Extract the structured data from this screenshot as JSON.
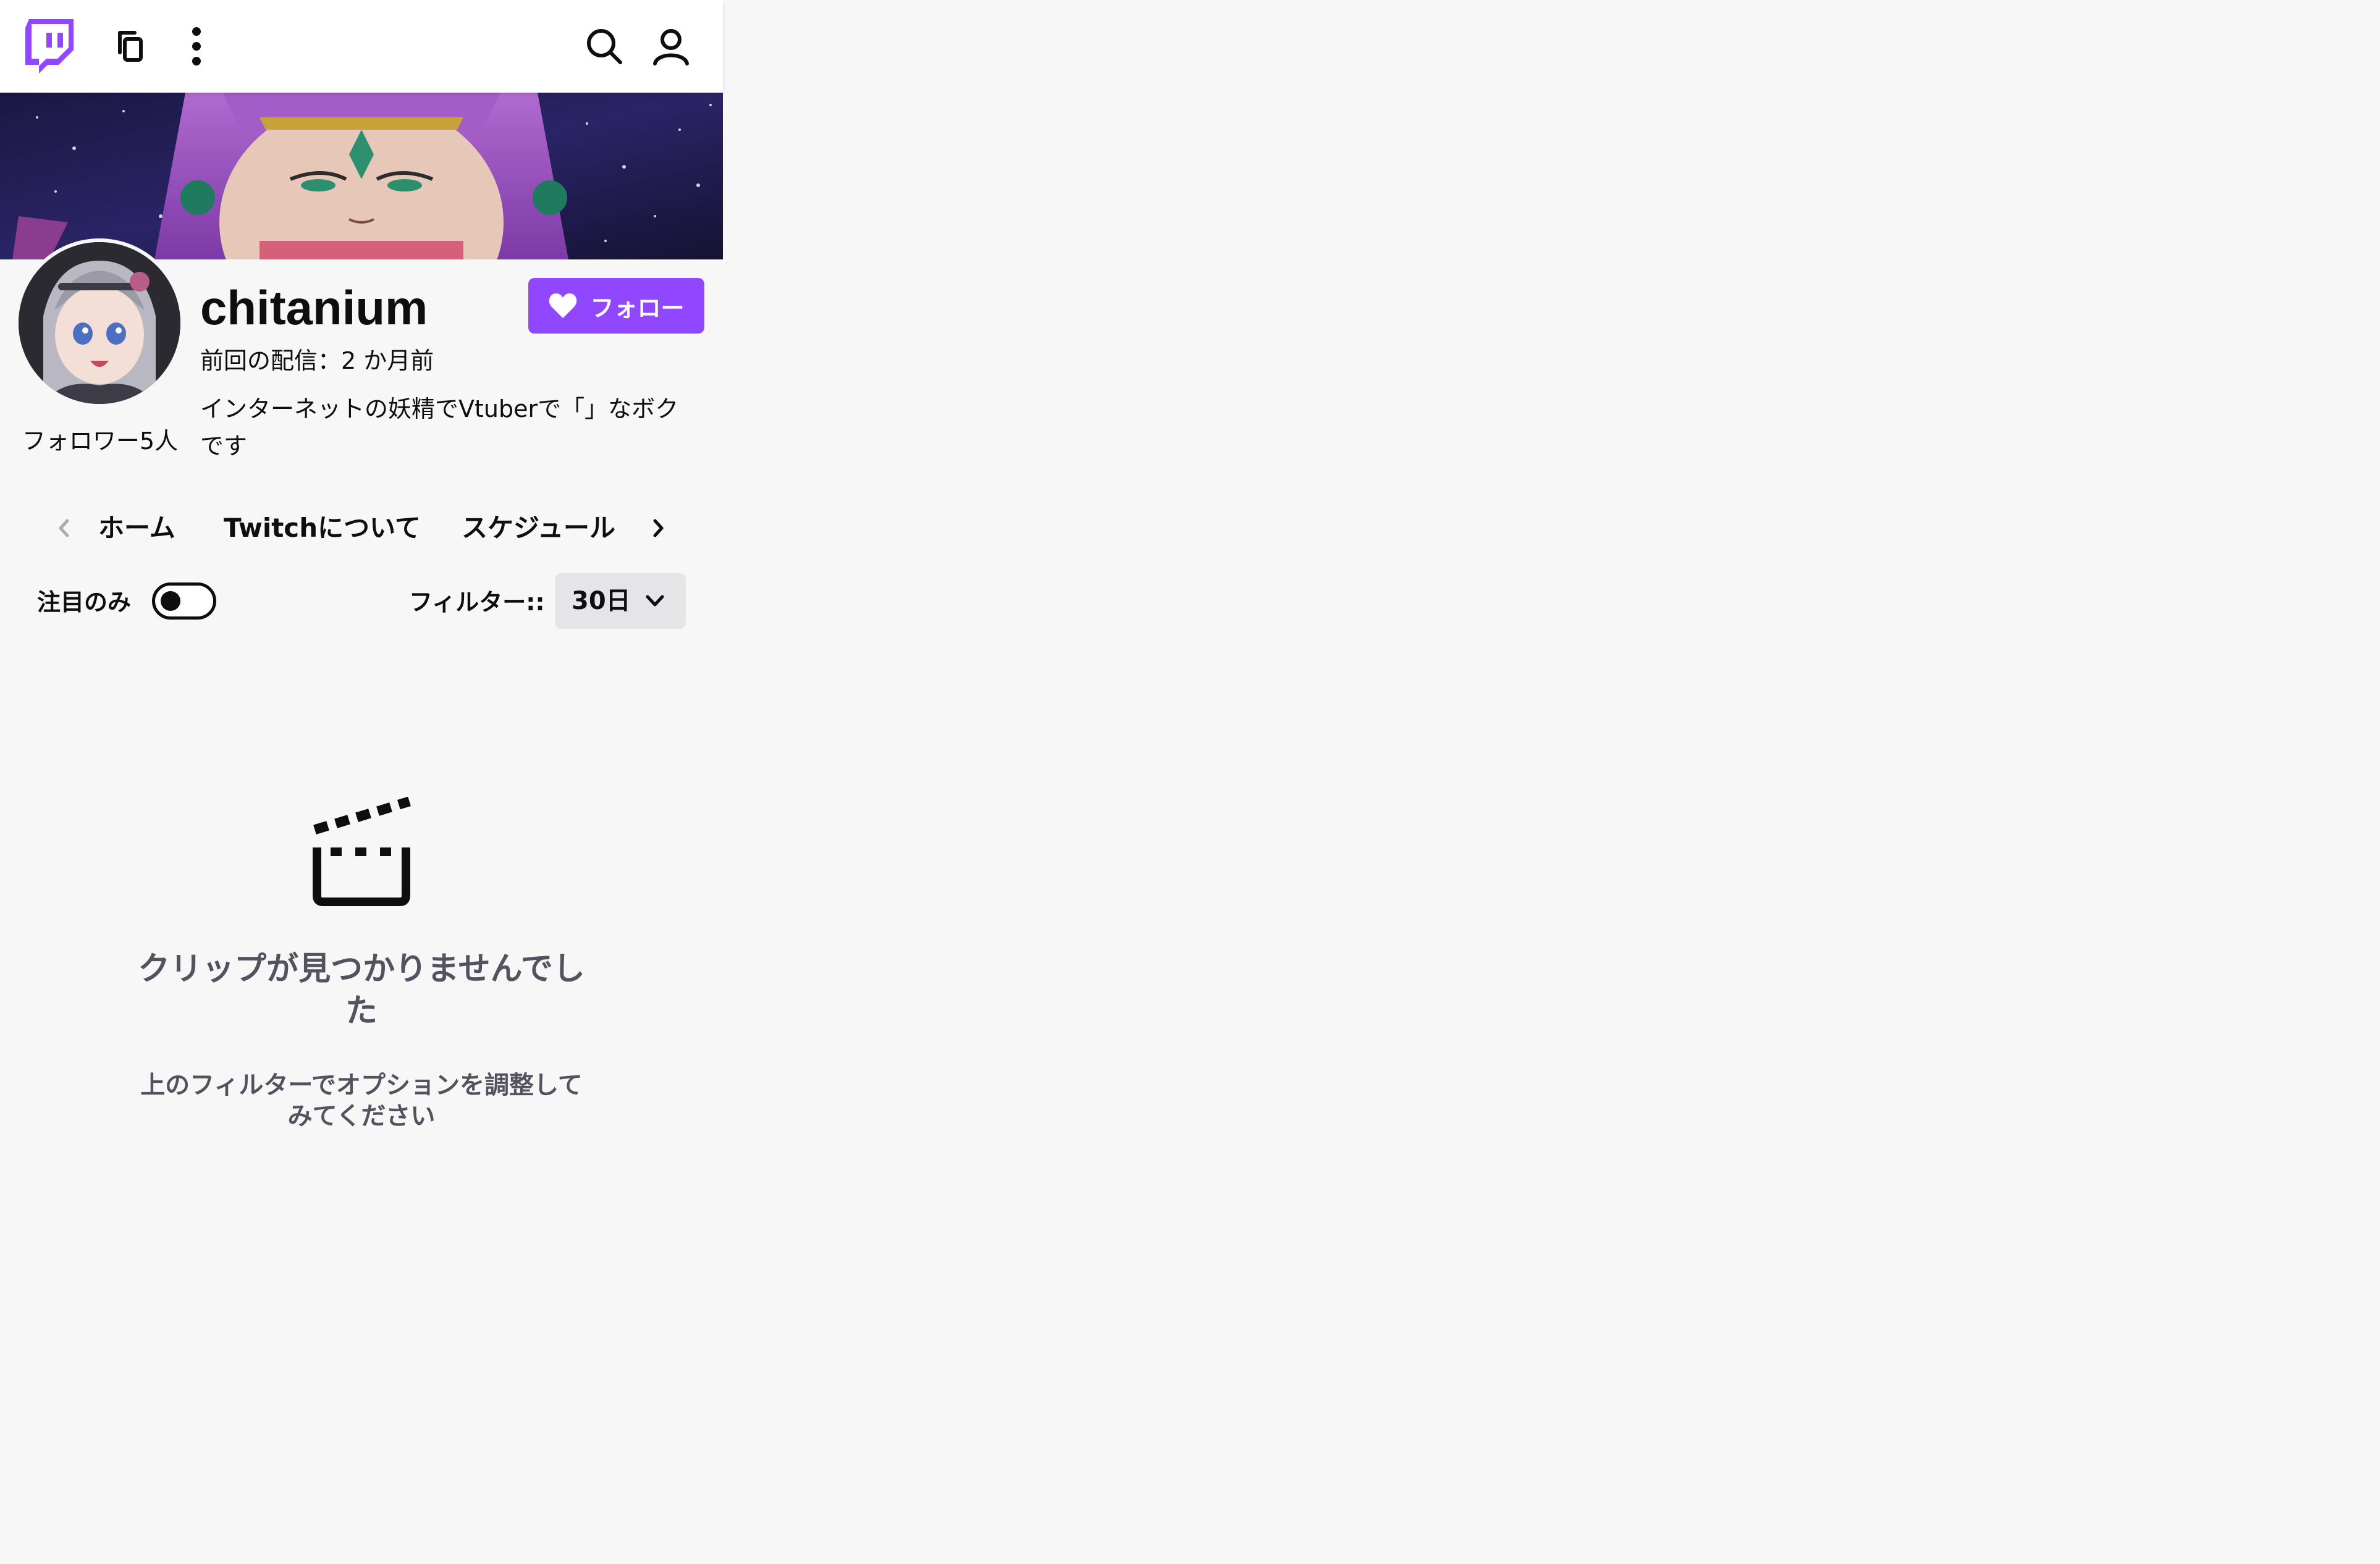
{
  "app": {
    "name": "Twitch"
  },
  "topnav": {
    "icons": [
      "twitch-logo-icon",
      "copy-icon",
      "more-vertical-icon",
      "search-icon",
      "user-icon"
    ]
  },
  "channel": {
    "name": "chitanium",
    "last_stream": "前回の配信：2 か月前",
    "bio": "インターネットの妖精でVtuberで「」なボクです",
    "followers": "フォロワー5人",
    "follow_label": "フォロー"
  },
  "tabs": {
    "items": [
      {
        "label": "ホーム"
      },
      {
        "label": "Twitchについて"
      },
      {
        "label": "スケジュール"
      }
    ]
  },
  "filters": {
    "featured_label": "注目のみ",
    "featured_on": false,
    "filter_label": "フィルター::",
    "period_value": "30日"
  },
  "empty_state": {
    "title": "クリップが見つかりませんでした",
    "description": "上のフィルターでオプションを調整してみてください"
  },
  "colors": {
    "brand": "#9147ff",
    "background": "#f7f7f8",
    "text": "#0e0e10",
    "muted_text": "#53535f"
  }
}
